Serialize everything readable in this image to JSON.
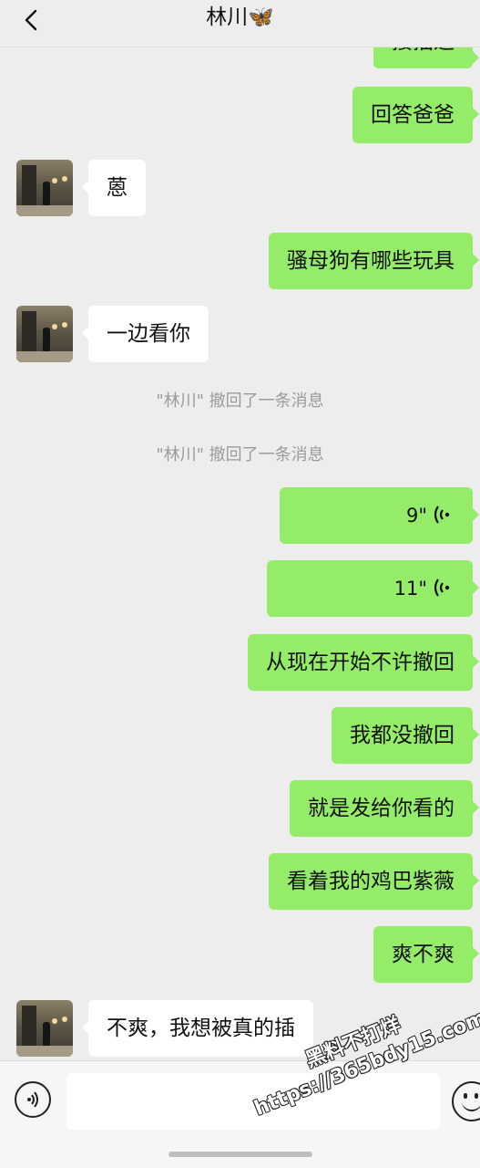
{
  "header": {
    "title": "林川",
    "title_emoji": "🦋"
  },
  "messages": {
    "m0": "接插进",
    "m1": "回答爸爸",
    "m2": "蒽",
    "m3": "骚母狗有哪些玩具",
    "m4": "一边看你",
    "n1": "\"林川\" 撤回了一条消息",
    "n2": "\"林川\" 撤回了一条消息",
    "v1": "9\"",
    "v2": "11\"",
    "m5": "从现在开始不许撤回",
    "m6": "我都没撤回",
    "m7": "就是发给你看的",
    "m8": "看着我的鸡巴紫薇",
    "m9": "爽不爽",
    "m10": "不爽，我想被真的插"
  },
  "input": {
    "placeholder": ""
  },
  "watermark": {
    "line1": "黑料不打烊",
    "line2": "https://365bdy15.com"
  },
  "colors": {
    "outgoing": "#95ec69",
    "incoming": "#ffffff",
    "background": "#ededed"
  }
}
